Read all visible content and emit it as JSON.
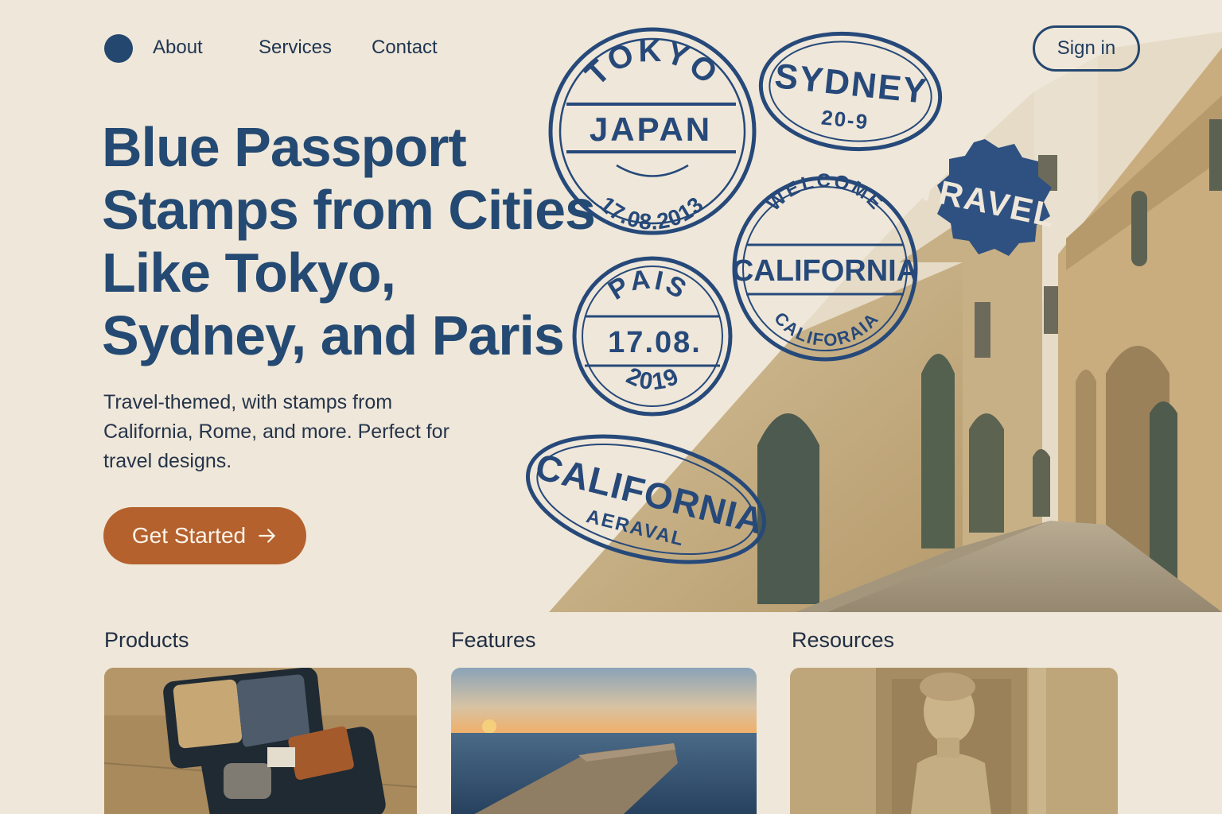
{
  "nav": {
    "about": "About",
    "services": "Services",
    "contact": "Contact",
    "signin": "Sign in"
  },
  "hero": {
    "title": "Blue Passport Stamps from Cities Like Tokyo, Sydney, and Paris",
    "subtitle": "Travel-themed, with stamps from California, Rome, and more. Perfect for travel designs.",
    "cta_label": "Get Started"
  },
  "stamps": {
    "tokyo_top": "TOKYO",
    "tokyo_mid": "JAPAN",
    "tokyo_date": "17.08.2013",
    "sydney_top": "SYDNEY",
    "sydney_date": "20-9",
    "travel": "TRAVEL",
    "welcome": "WELCOME",
    "california_mid": "CALIFORNIA",
    "california_bottom": "CALIFORAIA",
    "pais_top": "PAIS",
    "pais_mid": "17.08.",
    "pais_year": "2019",
    "oval_california": "CALIFORNIA",
    "oval_sub": "AERAVAL"
  },
  "sections": {
    "products": "Products",
    "features": "Features",
    "resources": "Resources"
  },
  "colors": {
    "background": "#efe7d9",
    "accent_blue": "#24476f",
    "cta_orange": "#b4612e"
  },
  "icons": [
    "arrow-right-icon"
  ]
}
